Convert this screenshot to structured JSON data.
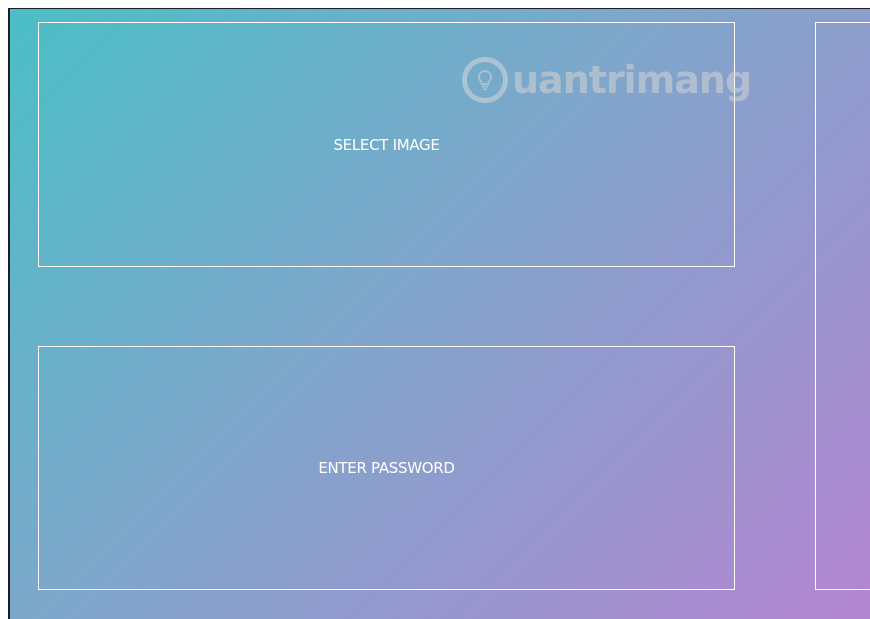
{
  "buttons": {
    "select_image": "SELECT IMAGE",
    "enter_password": "ENTER PASSWORD"
  },
  "watermark": {
    "text": "uantrimang"
  },
  "colors": {
    "gradient_start": "#4bbfc6",
    "gradient_mid": "#7fa6cb",
    "gradient_end": "#b485d1",
    "border": "#ffffff"
  }
}
